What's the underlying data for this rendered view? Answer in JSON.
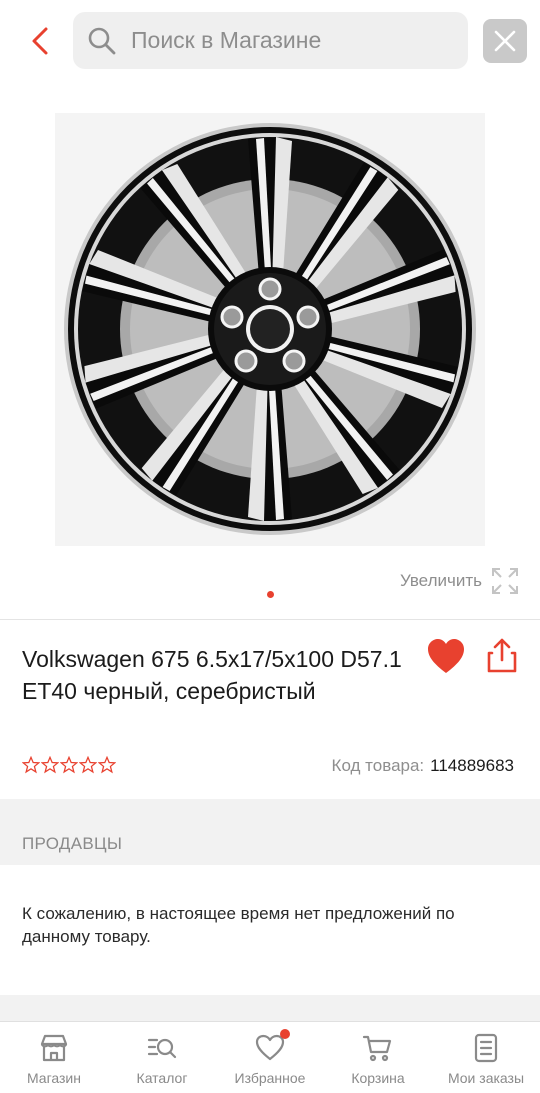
{
  "header": {
    "search_placeholder": "Поиск в Магазине"
  },
  "gallery": {
    "zoom_label": "Увеличить",
    "image_count": 1,
    "active_index": 0
  },
  "product": {
    "title": "Volkswagen 675 6.5x17/5x100 D57.1 ET40 черный, серебристый",
    "rating": 0,
    "rating_max": 5,
    "code_label": "Код товара:",
    "code_value": "114889683",
    "favorited": true
  },
  "sellers": {
    "title": "ПРОДАВЦЫ",
    "empty_message": "К сожалению, в настоящее время нет предложений по данному товару."
  },
  "bottom_nav": {
    "items": [
      {
        "label": "Магазин",
        "icon": "store-icon"
      },
      {
        "label": "Каталог",
        "icon": "catalog-search-icon"
      },
      {
        "label": "Избранное",
        "icon": "heart-outline-icon",
        "badge": true
      },
      {
        "label": "Корзина",
        "icon": "cart-icon"
      },
      {
        "label": "Мои заказы",
        "icon": "orders-icon"
      }
    ]
  },
  "colors": {
    "accent": "#e8412f",
    "muted_text": "#8e8e8e",
    "section_bg": "#f2f2f2"
  }
}
